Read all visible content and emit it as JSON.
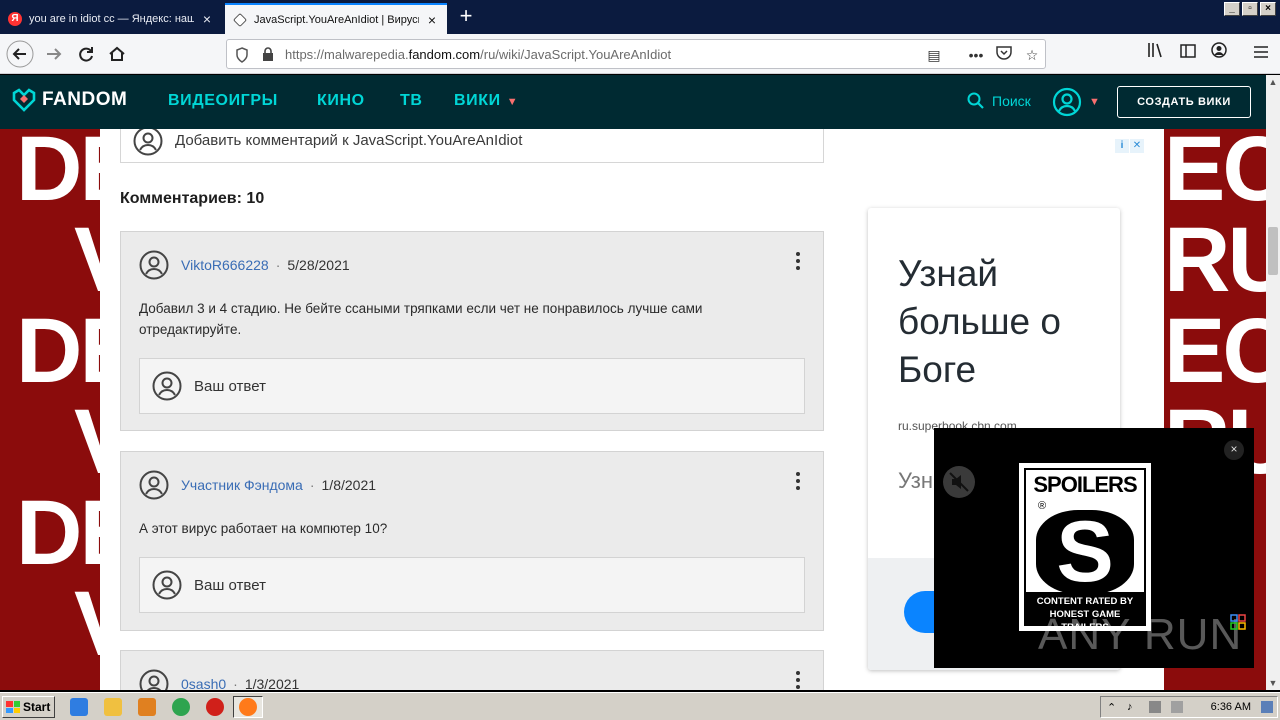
{
  "browser": {
    "tabs": [
      {
        "label": "you are in idiot cc — Яндекс: нашл",
        "favicon": "yandex-icon",
        "active": false
      },
      {
        "label": "JavaScript.YouAreAnIdiot | Вирусы",
        "favicon": "fandom-icon",
        "active": true
      }
    ],
    "url_prefix": "https://malwarepedia.",
    "url_domain": "fandom.com",
    "url_path": "/ru/wiki/JavaScript.YouAreAnIdiot"
  },
  "fandom_nav": {
    "logo": "FANDOM",
    "items": [
      "ВИДЕОИГРЫ",
      "КИНО",
      "ТВ",
      "ВИКИ"
    ],
    "search": "Поиск",
    "create_wiki": "СОЗДАТЬ ВИКИ"
  },
  "background_words": [
    "DE",
    "ECT",
    "V",
    "RUS",
    "DE",
    "ECT",
    "V",
    "RUS",
    "DE",
    "V"
  ],
  "comments_section": {
    "add_placeholder": "Добавить комментарий к JavaScript.YouAreAnIdiot",
    "count_label": "Комментариев: 10",
    "reply_placeholder": "Ваш ответ",
    "comments": [
      {
        "author": "ViktoR666228",
        "date": "5/28/2021",
        "text": "Добавил 3 и 4 стадию. Не бейте ссаными тряпками если чет не понравилось лучше сами отредактируйте."
      },
      {
        "author": "Участник Фэндома",
        "date": "1/8/2021",
        "text": "А этот вирус работает на компютер 10?"
      },
      {
        "author": "0sash0",
        "date": "1/3/2021",
        "text": ""
      }
    ]
  },
  "ad": {
    "title": "Узнай больше о Боге",
    "site": "ru.superbook.cbn.com",
    "subtitle": "Узн"
  },
  "video_overlay": {
    "rating_top": "SPOILERS",
    "rating_reg": "®",
    "rating_letter": "S",
    "rating_bottom_1": "CONTENT RATED BY",
    "rating_bottom_2": "HONEST GAME TRAILERS",
    "watermark": "ANY RUN",
    "close": "×"
  },
  "taskbar": {
    "start": "Start",
    "clock": "6:36 AM"
  },
  "colors": {
    "fandom_bar": "#002a32",
    "fandom_link": "#00d6d6",
    "accent_red": "#f76f6f",
    "page_bg": "#8b0c0c",
    "author_link": "#3a6db5"
  }
}
